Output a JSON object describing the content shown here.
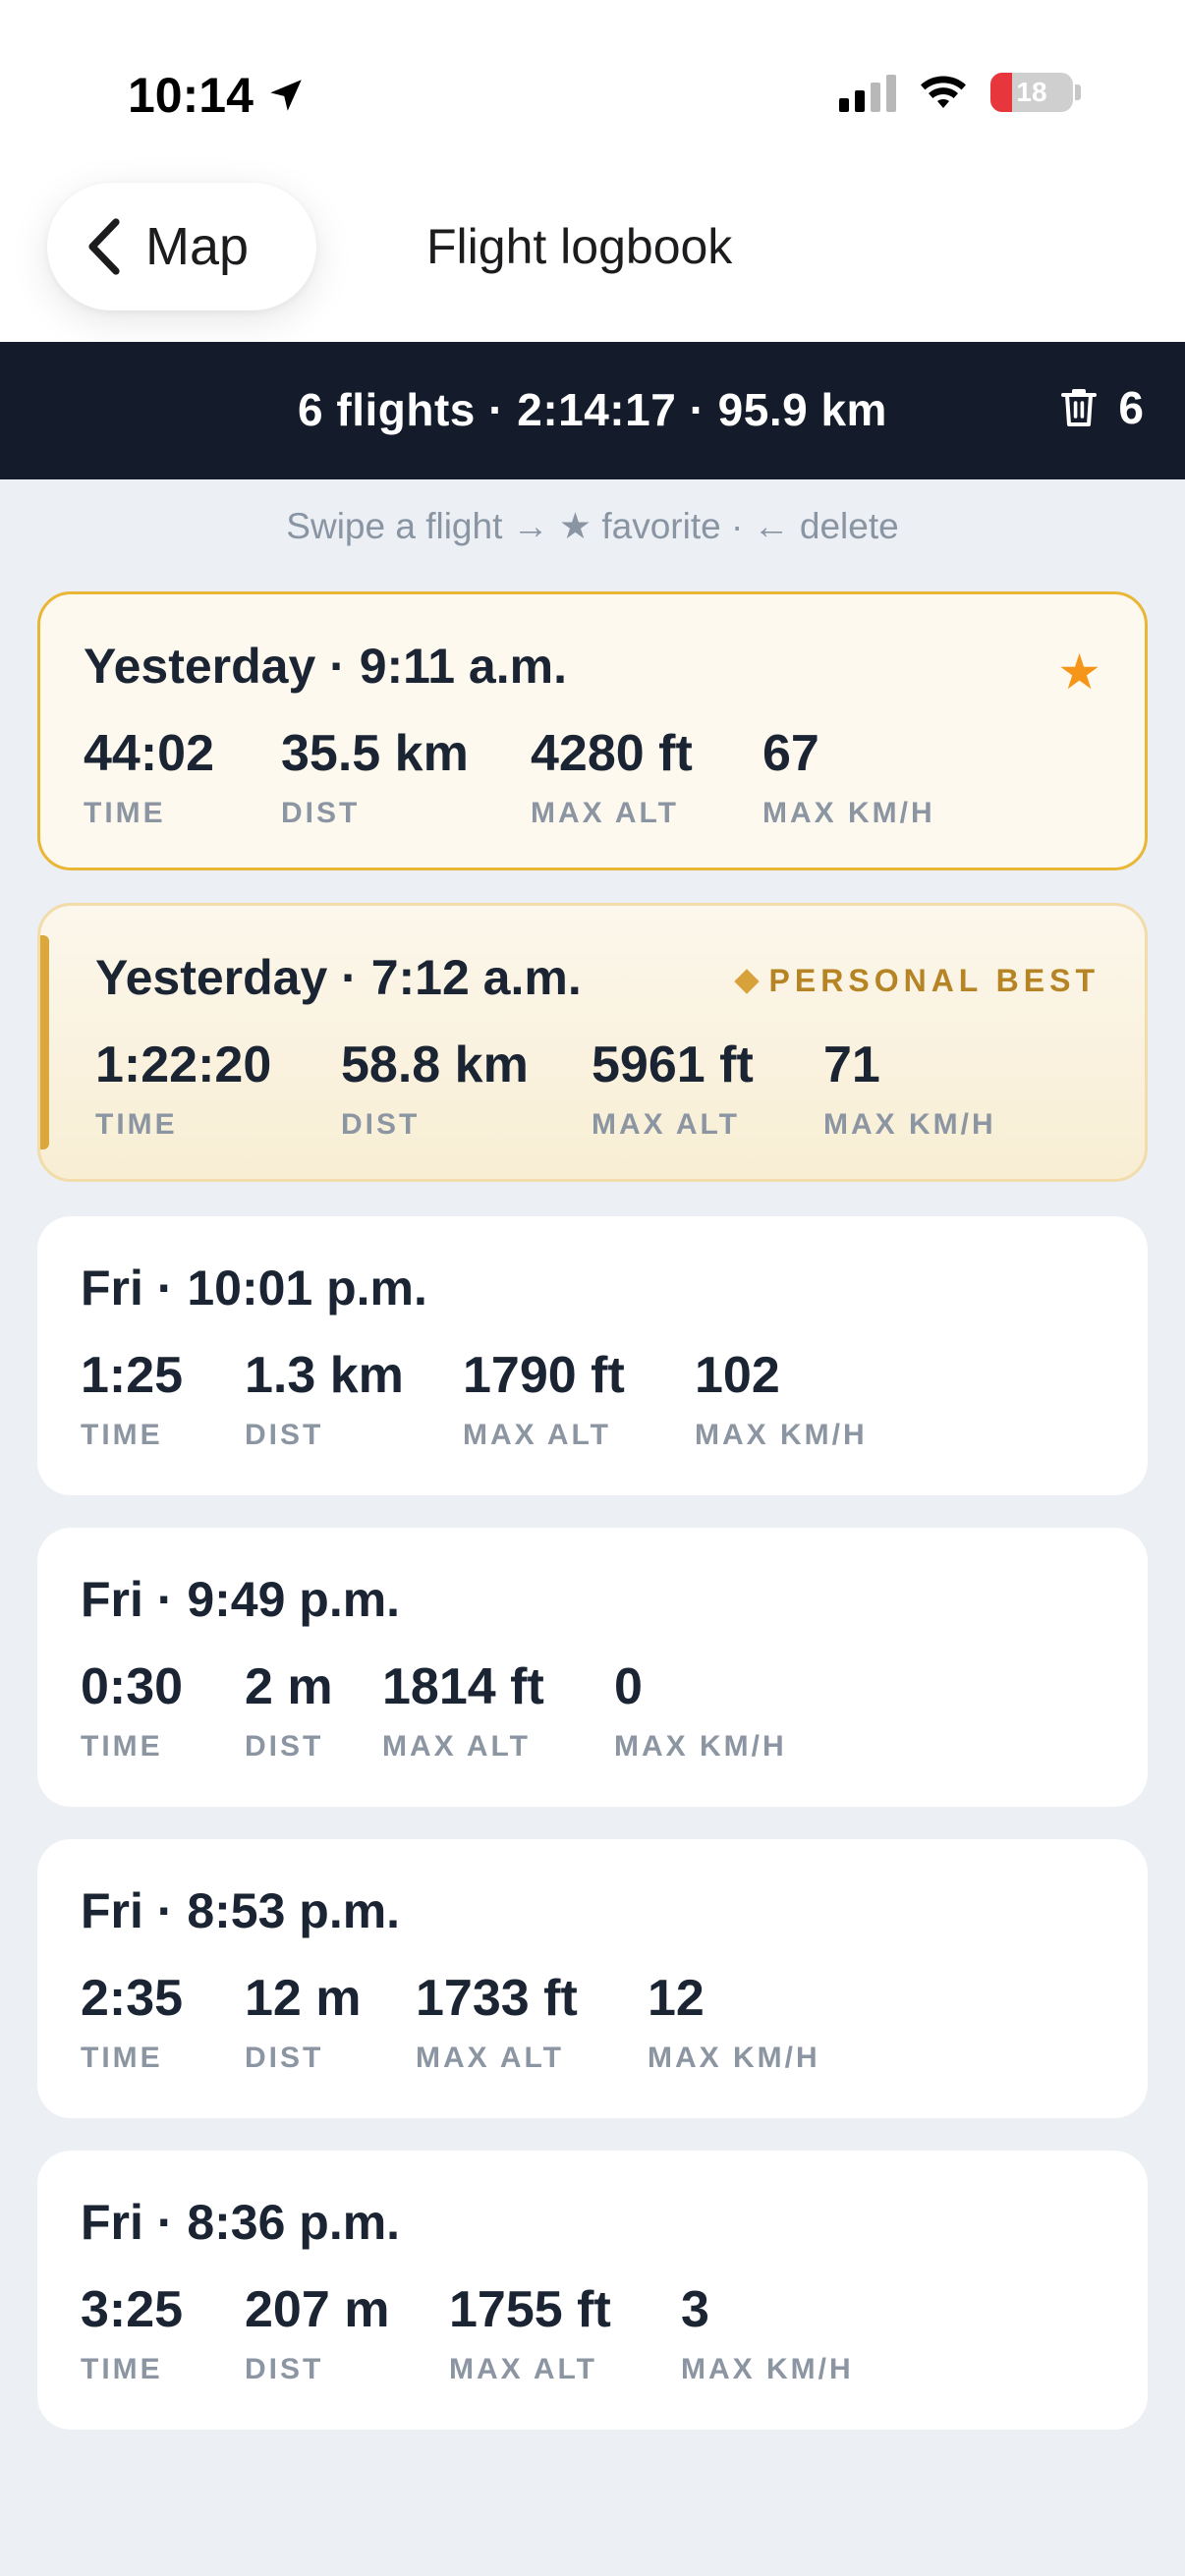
{
  "status_bar": {
    "time": "10:14",
    "battery": "18"
  },
  "nav": {
    "back_label": "Map",
    "title": "Flight logbook"
  },
  "summary": {
    "text": "6 flights · 2:14:17 · 95.9 km",
    "delete_count": "6"
  },
  "hint": "Swipe a flight → ★ favorite · ← delete",
  "stat_labels": {
    "time": "TIME",
    "dist": "DIST",
    "max_alt": "MAX ALT",
    "max_speed": "MAX KM/H"
  },
  "flights": [
    {
      "title": "Yesterday · 9:11 a.m.",
      "favorite": true,
      "time": "44:02",
      "dist": "35.5 km",
      "max_alt": "4280 ft",
      "max_speed": "67"
    },
    {
      "title": "Yesterday · 7:12 a.m.",
      "badge": "PERSONAL BEST",
      "time": "1:22:20",
      "dist": "58.8 km",
      "max_alt": "5961 ft",
      "max_speed": "71"
    },
    {
      "title": "Fri · 10:01 p.m.",
      "time": "1:25",
      "dist": "1.3 km",
      "max_alt": "1790 ft",
      "max_speed": "102"
    },
    {
      "title": "Fri · 9:49 p.m.",
      "time": "0:30",
      "dist": "2 m",
      "max_alt": "1814 ft",
      "max_speed": "0"
    },
    {
      "title": "Fri · 8:53 p.m.",
      "time": "2:35",
      "dist": "12 m",
      "max_alt": "1733 ft",
      "max_speed": "12"
    },
    {
      "title": "Fri · 8:36 p.m.",
      "time": "3:25",
      "dist": "207 m",
      "max_alt": "1755 ft",
      "max_speed": "3"
    }
  ],
  "colors": {
    "accent_star": "#f5961a",
    "favorite_border": "#eab636",
    "personal_best": "#b68424",
    "summary_bg": "#141c2b"
  }
}
